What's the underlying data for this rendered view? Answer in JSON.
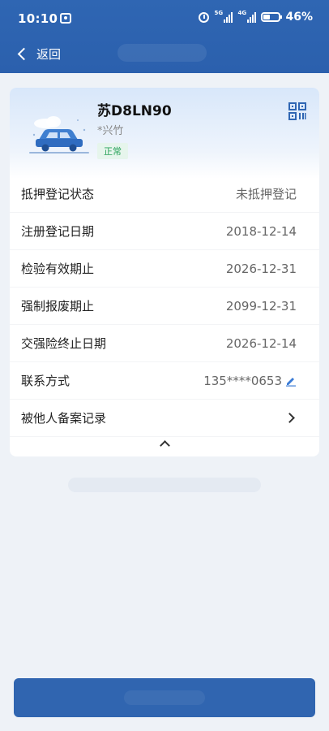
{
  "status_bar": {
    "time": "10:10",
    "battery": "46%",
    "sim1_tag": "5G",
    "sim2_tag": "4G"
  },
  "nav": {
    "back_label": "返回"
  },
  "vehicle": {
    "plate": "苏D8LN90",
    "owner": "*兴竹",
    "status": "正常"
  },
  "details": [
    {
      "label": "抵押登记状态",
      "value": "未抵押登记"
    },
    {
      "label": "注册登记日期",
      "value": "2018-12-14"
    },
    {
      "label": "检验有效期止",
      "value": "2026-12-31"
    },
    {
      "label": "强制报废期止",
      "value": "2099-12-31"
    },
    {
      "label": "交强险终止日期",
      "value": "2026-12-14"
    },
    {
      "label": "联系方式",
      "value": "135****0653"
    },
    {
      "label": "被他人备案记录",
      "value": ""
    }
  ],
  "colors": {
    "header_blue": "#2f66b3",
    "status_green": "#2aa35b",
    "status_green_bg": "#e6f5ec",
    "primary_button": "#3065b0"
  }
}
